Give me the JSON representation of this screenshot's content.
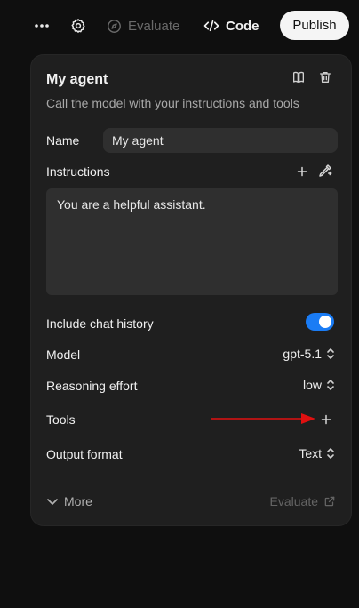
{
  "toolbar": {
    "more_icon": "ellipsis-icon",
    "settings_icon": "gear-icon",
    "evaluate_label": "Evaluate",
    "code_label": "Code",
    "publish_label": "Publish"
  },
  "agent": {
    "title": "My agent",
    "subtitle": "Call the model with your instructions and tools",
    "name_label": "Name",
    "name_value": "My agent",
    "instructions_label": "Instructions",
    "instructions_value": "You are a helpful assistant.",
    "chat_history_label": "Include chat history",
    "chat_history_enabled": true,
    "model_label": "Model",
    "model_value": "gpt-5.1",
    "reasoning_label": "Reasoning effort",
    "reasoning_value": "low",
    "tools_label": "Tools",
    "output_label": "Output format",
    "output_value": "Text",
    "more_label": "More",
    "evaluate_label": "Evaluate"
  },
  "colors": {
    "background": "#0f0f0f",
    "panel": "#1f1f1f",
    "field": "#2f2f2f",
    "toggle_on": "#1a7cf5",
    "arrow": "#e01010"
  }
}
